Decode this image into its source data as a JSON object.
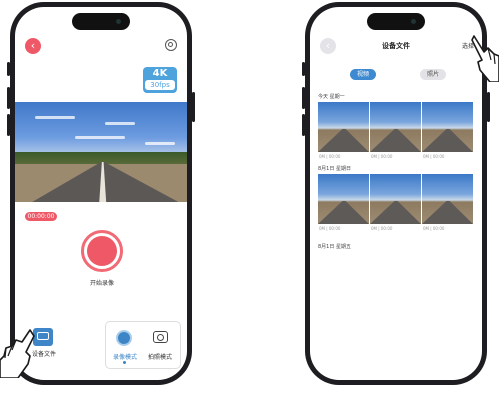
{
  "left_phone": {
    "quality_badge": {
      "resolution": "4K",
      "fps": "30fps"
    },
    "timer": "00:00:00",
    "record_label": "开始录像",
    "device_files_label": "设备文件",
    "modes": {
      "video_label": "录像模式",
      "photo_label": "拍照模式"
    }
  },
  "right_phone": {
    "title": "设备文件",
    "select_label": "选择",
    "tabs": {
      "video": "视频",
      "photo": "照片"
    },
    "sections": [
      {
        "date": "今天 星期一",
        "meta": [
          "0M | 00:00",
          "0M | 00:00",
          "0M | 00:00"
        ]
      },
      {
        "date": "8月1日 星期日",
        "meta": [
          "0M | 00:00",
          "0M | 00:00",
          "0M | 00:00"
        ]
      },
      {
        "date": "8月1日 星期五",
        "meta": []
      }
    ]
  },
  "colors": {
    "record_red": "#ef5967",
    "accent_blue": "#3e8ad0",
    "phone_frame": "#1e1e22"
  },
  "icons": [
    "back-arrow-icon",
    "gear-icon",
    "device-files-icon",
    "video-mode-icon",
    "camera-icon",
    "hand-pointer-icon"
  ]
}
